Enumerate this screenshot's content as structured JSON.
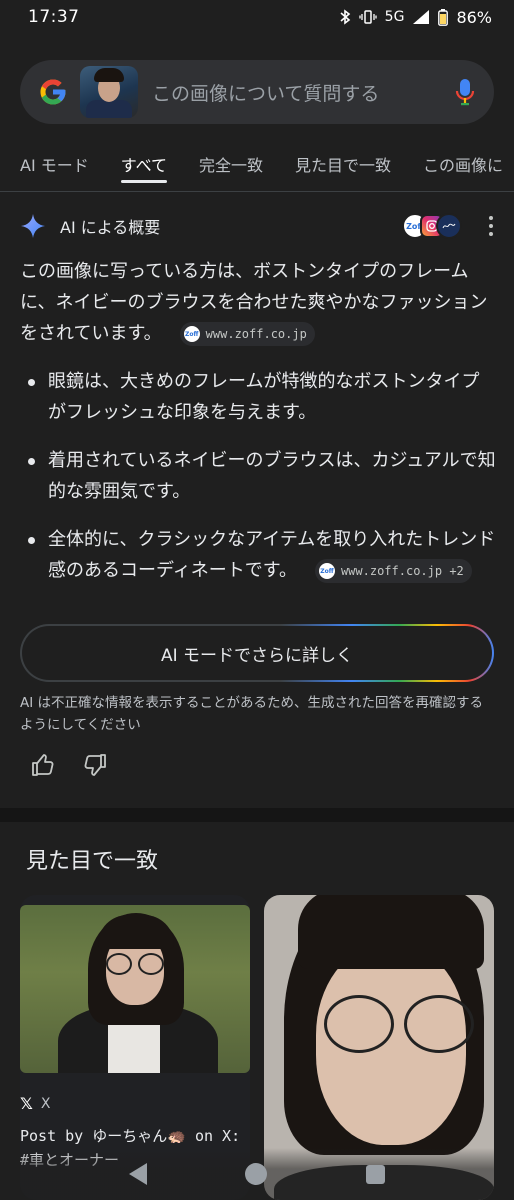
{
  "status_bar": {
    "time": "17:37",
    "network": "5G",
    "battery": "86%"
  },
  "search": {
    "placeholder": "この画像について質問する"
  },
  "tabs": [
    "AI モード",
    "すべて",
    "完全一致",
    "見た目で一致",
    "この画像に"
  ],
  "active_tab": "すべて",
  "ai_overview": {
    "title": "AI による概要",
    "source_icons": [
      "Zoff",
      "instagram-icon",
      "navy-circle"
    ],
    "summary": "この画像に写っている方は、ボストンタイプのフレームに、ネイビーのブラウスを合わせた爽やかなファッションをされています。",
    "summary_source": "www.zoff.co.jp",
    "bullets": [
      "眼鏡は、大きめのフレームが特徴的なボストンタイプがフレッシュな印象を与えます。",
      "着用されているネイビーのブラウスは、カジュアルで知的な雰囲気です。",
      "全体的に、クラシックなアイテムを取り入れたトレンド感のあるコーディネートです。"
    ],
    "last_bullet_source": "www.zoff.co.jp +2",
    "ai_mode_button": "AI モードでさらに詳しく",
    "disclaimer": "AI は不正確な情報を表示することがあるため、生成された回答を再確認するようにしてください"
  },
  "visual_matches": {
    "title": "見た目で一致",
    "cards": [
      {
        "source": "X",
        "caption": "Post by ゆーちゃん🦔 on X: #車とオーナー"
      },
      {
        "source": "",
        "caption": ""
      }
    ]
  },
  "colors": {
    "background": "#1f1f1f",
    "search_bg": "#303134",
    "accent_blue": "#4285f4"
  }
}
